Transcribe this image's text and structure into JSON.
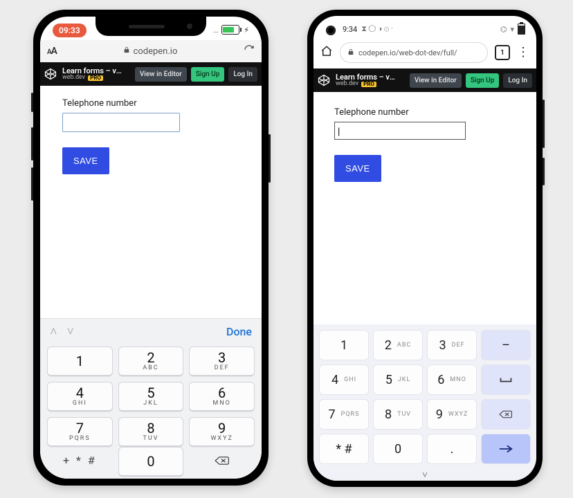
{
  "iphone": {
    "status": {
      "time": "09:33",
      "signal_dots": "....",
      "battery_icon": "charging"
    },
    "safari": {
      "aa_small": "A",
      "aa_big": "A",
      "url_text": "codepen.io",
      "lock_icon": "lock",
      "reload_icon": "reload"
    },
    "codepen": {
      "title": "Learn forms – virt…",
      "author": "web.dev",
      "pro_badge": "PRO",
      "view_btn": "View in Editor",
      "signup_btn": "Sign Up",
      "login_btn": "Log In"
    },
    "form": {
      "label": "Telephone number",
      "value": "",
      "save": "SAVE"
    },
    "kb": {
      "prev_icon": "chevron-up",
      "next_icon": "chevron-down",
      "done": "Done",
      "keys": [
        {
          "d": "1",
          "l": ""
        },
        {
          "d": "2",
          "l": "ABC"
        },
        {
          "d": "3",
          "l": "DEF"
        },
        {
          "d": "4",
          "l": "GHI"
        },
        {
          "d": "5",
          "l": "JKL"
        },
        {
          "d": "6",
          "l": "MNO"
        },
        {
          "d": "7",
          "l": "PQRS"
        },
        {
          "d": "8",
          "l": "TUV"
        },
        {
          "d": "9",
          "l": "WXYZ"
        }
      ],
      "sym": "+ * #",
      "zero": "0",
      "back_icon": "backspace"
    }
  },
  "android": {
    "status": {
      "time": "9:34",
      "left_icons": "⧗ ◯ ◑ ⊙ ·",
      "right_icons": "⌬ ▾ ◐"
    },
    "chrome": {
      "home_icon": "home",
      "lock_icon": "lock",
      "url_text": "codepen.io/web-dot-dev/full/",
      "tab_count": "1",
      "more_icon": "more-vert"
    },
    "codepen": {
      "title": "Learn forms – virt…",
      "author": "web.dev",
      "pro_badge": "PRO",
      "view_btn": "View in Editor",
      "signup_btn": "Sign Up",
      "login_btn": "Log In"
    },
    "form": {
      "label": "Telephone number",
      "value": "",
      "cursor": "|",
      "save": "SAVE"
    },
    "kb": {
      "rows": [
        [
          {
            "d": "1",
            "l": ""
          },
          {
            "d": "2",
            "l": "ABC"
          },
          {
            "d": "3",
            "l": "DEF"
          },
          {
            "d": "–",
            "l": "",
            "side": true
          }
        ],
        [
          {
            "d": "4",
            "l": "GHI"
          },
          {
            "d": "5",
            "l": "JKL"
          },
          {
            "d": "6",
            "l": "MNO"
          },
          {
            "d": "␣",
            "l": "",
            "side": true,
            "space": true
          }
        ],
        [
          {
            "d": "7",
            "l": "PQRS"
          },
          {
            "d": "8",
            "l": "TUV"
          },
          {
            "d": "9",
            "l": "WXYZ"
          },
          {
            "d": "⌫",
            "l": "",
            "side": true,
            "back": true
          }
        ],
        [
          {
            "d": "* #",
            "l": ""
          },
          {
            "d": "0",
            "l": ""
          },
          {
            "d": ".",
            "l": ""
          },
          {
            "d": "→",
            "l": "",
            "go": true
          }
        ]
      ],
      "collapse_icon": "chevron-down"
    }
  }
}
